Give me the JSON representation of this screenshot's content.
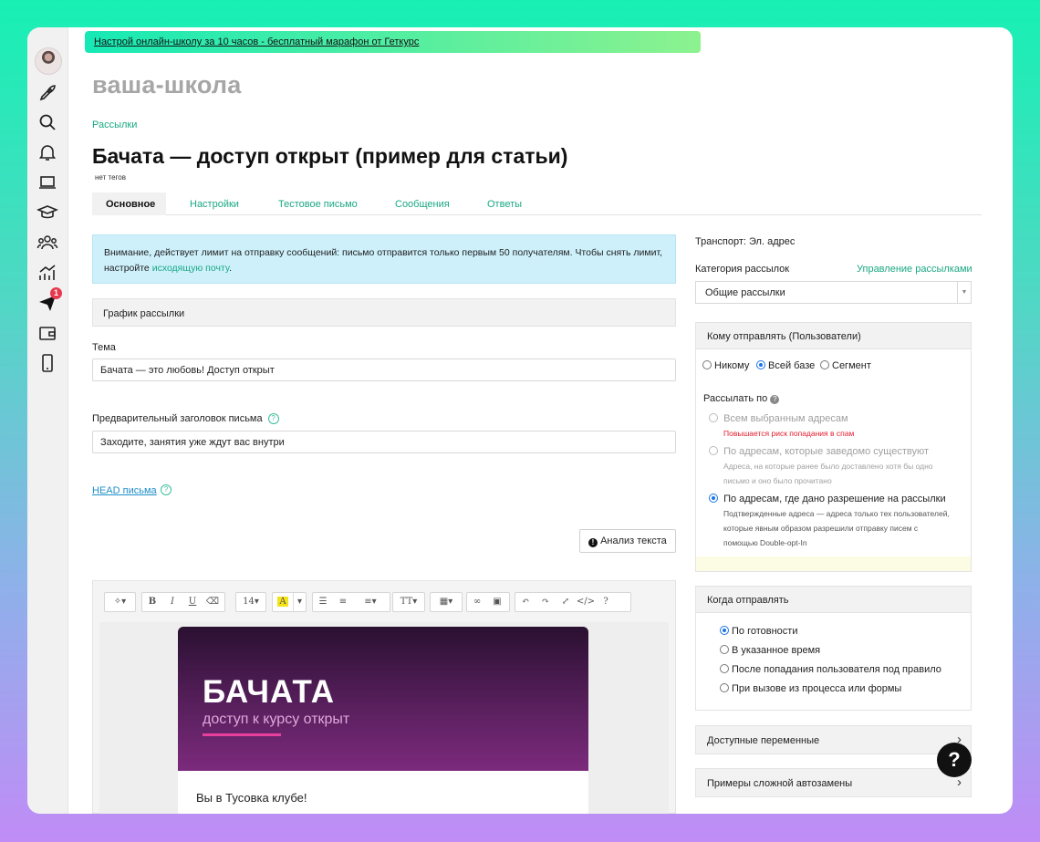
{
  "promo_banner": "Настрой онлайн-школу за 10 часов - бесплатный марафон от Геткурс",
  "school_name": "ваша-школа",
  "breadcrumb": "Рассылки",
  "page_title": "Бачата — доступ открыт (пример для статьи)",
  "tags": "нет тегов",
  "tabs": [
    "Основное",
    "Настройки",
    "Тестовое письмо",
    "Сообщения",
    "Ответы"
  ],
  "sidebar": {
    "icons": [
      "avatar",
      "rocket-icon",
      "search-icon",
      "bell-icon",
      "laptop-icon",
      "graduation-cap-icon",
      "users-icon",
      "chart-icon",
      "send-icon",
      "wallet-icon",
      "phone-icon"
    ],
    "notification_count": "1"
  },
  "alert": {
    "text": "Внимание, действует лимит на отправку сообщений: письмо отправится только первым 50 получателям. Чтобы снять лимит, настройте ",
    "link": "исходящую почту",
    "end": "."
  },
  "schedule_label": "График рассылки",
  "subject": {
    "label": "Тема",
    "value": "Бачата — это любовь! Доступ открыт"
  },
  "preheader": {
    "label": "Предварительный заголовок письма",
    "value": "Заходите, занятия уже ждут вас внутри"
  },
  "head_link": "HEAD письма",
  "analyze_button": "Анализ текста",
  "editor": {
    "font_size": "14",
    "hero_title": "БАЧАТА",
    "hero_subtitle": "доступ к курсу открыт",
    "body_text": "Вы в Тусовка клубе!"
  },
  "right": {
    "transport": "Транспорт: Эл. адрес",
    "category_label": "Категория рассылок",
    "manage_link": "Управление рассылками",
    "category_value": "Общие рассылки",
    "recipients": {
      "title": "Кому отправлять (Пользователи)",
      "options": [
        "Никому",
        "Всей базе",
        "Сегмент"
      ],
      "selected": "Всей базе"
    },
    "send_by": {
      "label": "Рассылать по",
      "options": [
        {
          "label": "Всем выбранным адресам",
          "note": "Повышается риск попадания в спам"
        },
        {
          "label": "По адресам, которые заведомо существуют",
          "note": "Адреса, на которые ранее было доставлено хотя бы одно письмо и оно было прочитано"
        },
        {
          "label": "По адресам, где дано разрешение на рассылки",
          "note": "Подтвержденные адреса — адреса только тех пользователей, которые явным образом разрешили отправку писем с помощью Double-opt-In"
        }
      ]
    },
    "when": {
      "title": "Когда отправлять",
      "options": [
        "По готовности",
        "В указанное время",
        "После попадания пользователя под правило",
        "При вызове из процесса или формы"
      ]
    },
    "variables": "Доступные переменные",
    "autoreplace": "Примеры сложной автозамены"
  },
  "help_fab": "?"
}
